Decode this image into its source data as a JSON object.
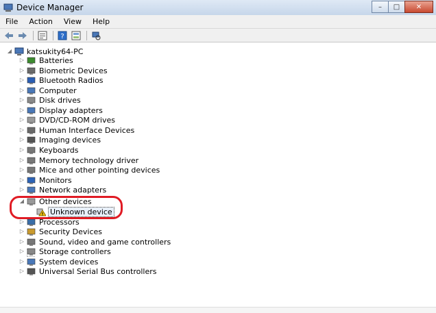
{
  "window": {
    "title": "Device Manager"
  },
  "menu": [
    "File",
    "Action",
    "View",
    "Help"
  ],
  "toolbar": {
    "icons": [
      "back-icon",
      "forward-icon",
      "properties-icon",
      "help-icon",
      "update-driver-icon",
      "scan-hardware-icon"
    ]
  },
  "tree": {
    "root": "katsukity64-PC",
    "categories": [
      {
        "label": "Batteries",
        "icon": "battery-icon"
      },
      {
        "label": "Biometric Devices",
        "icon": "biometric-icon"
      },
      {
        "label": "Bluetooth Radios",
        "icon": "bluetooth-icon"
      },
      {
        "label": "Computer",
        "icon": "computer-icon"
      },
      {
        "label": "Disk drives",
        "icon": "disk-drive-icon"
      },
      {
        "label": "Display adapters",
        "icon": "display-adapter-icon"
      },
      {
        "label": "DVD/CD-ROM drives",
        "icon": "dvd-drive-icon"
      },
      {
        "label": "Human Interface Devices",
        "icon": "hid-icon"
      },
      {
        "label": "Imaging devices",
        "icon": "camera-icon"
      },
      {
        "label": "Keyboards",
        "icon": "keyboard-icon"
      },
      {
        "label": "Memory technology driver",
        "icon": "memory-icon"
      },
      {
        "label": "Mice and other pointing devices",
        "icon": "mouse-icon"
      },
      {
        "label": "Monitors",
        "icon": "monitor-icon"
      },
      {
        "label": "Network adapters",
        "icon": "network-icon"
      },
      {
        "label": "Other devices",
        "icon": "other-devices-icon",
        "expanded": true
      },
      {
        "label": "Processors",
        "icon": "processor-icon"
      },
      {
        "label": "Security Devices",
        "icon": "security-icon"
      },
      {
        "label": "Sound, video and game controllers",
        "icon": "sound-icon"
      },
      {
        "label": "Storage controllers",
        "icon": "storage-icon"
      },
      {
        "label": "System devices",
        "icon": "system-icon"
      },
      {
        "label": "Universal Serial Bus controllers",
        "icon": "usb-icon"
      }
    ],
    "other_devices_child": {
      "label": "Unknown device",
      "icon": "warning-device-icon"
    }
  },
  "colors": {
    "highlight_ring": "#e01b24",
    "selection_bg": "#e8f0fb"
  }
}
